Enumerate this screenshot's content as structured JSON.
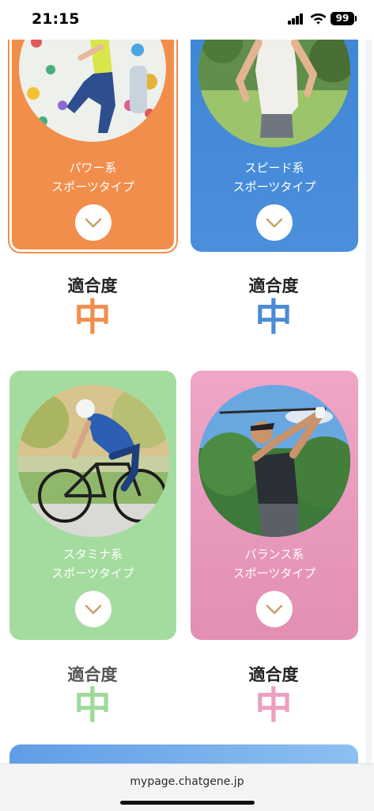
{
  "status_bar": {
    "time": "21:15",
    "battery": "99"
  },
  "cards": [
    {
      "label_line1": "パワー系",
      "label_line2": "スポーツタイプ",
      "color": "#f28e4b"
    },
    {
      "label_line1": "スピード系",
      "label_line2": "スポーツタイプ",
      "color": "#4a8bd6"
    },
    {
      "label_line1": "スタミナ系",
      "label_line2": "スポーツタイプ",
      "color": "#9ed99a"
    },
    {
      "label_line1": "バランス系",
      "label_line2": "スポーツタイプ",
      "color": "#ec9fc0"
    }
  ],
  "fit": [
    {
      "heading": "適合度",
      "value": "中",
      "color": "#f28e4b"
    },
    {
      "heading": "適合度",
      "value": "中",
      "color": "#4a8bd6"
    },
    {
      "heading": "適合度",
      "value": "中",
      "color": "#9ed99a"
    },
    {
      "heading": "適合度",
      "value": "中",
      "color": "#ec9fc0"
    }
  ],
  "browser": {
    "url": "mypage.chatgene.jp"
  }
}
